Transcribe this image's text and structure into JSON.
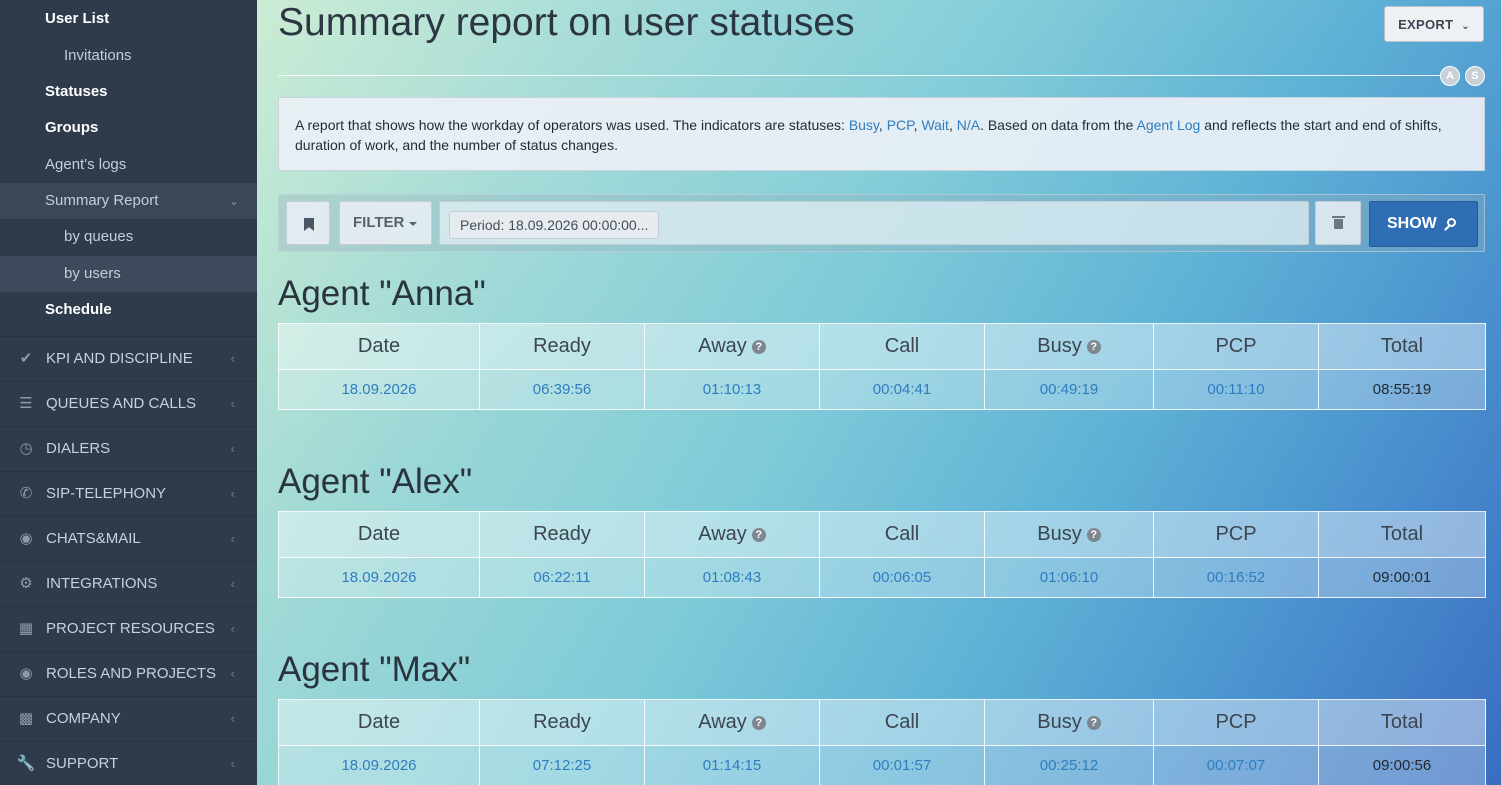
{
  "sidebar": {
    "sub_items": [
      {
        "label": "User List"
      },
      {
        "label": "Invitations"
      },
      {
        "label": "Statuses"
      },
      {
        "label": "Groups"
      },
      {
        "label": "Agent's logs"
      },
      {
        "label": "Summary Report"
      },
      {
        "label": "by queues"
      },
      {
        "label": "by users"
      },
      {
        "label": "Schedule"
      }
    ],
    "menu": [
      {
        "label": "KPI AND DISCIPLINE",
        "icon": "check-icon"
      },
      {
        "label": "QUEUES AND CALLS",
        "icon": "list-icon"
      },
      {
        "label": "DIALERS",
        "icon": "clock-icon"
      },
      {
        "label": "SIP-TELEPHONY",
        "icon": "phone-icon"
      },
      {
        "label": "CHATS&MAIL",
        "icon": "chat-icon"
      },
      {
        "label": "INTEGRATIONS",
        "icon": "gears-icon"
      },
      {
        "label": "PROJECT RESOURCES",
        "icon": "grid-icon"
      },
      {
        "label": "ROLES AND PROJECTS",
        "icon": "toggle-icon"
      },
      {
        "label": "COMPANY",
        "icon": "bar-chart-icon"
      },
      {
        "label": "SUPPORT",
        "icon": "wrench-icon"
      }
    ]
  },
  "header": {
    "title": "Summary report on user statuses",
    "export_label": "EXPORT",
    "badge_a": "A",
    "badge_s": "S"
  },
  "info": {
    "text1": "A report that shows how the workday of operators was used. The indicators are statuses: ",
    "busy": "Busy",
    "sep1": ", ",
    "pcp": "PCP",
    "sep2": ", ",
    "wait": "Wait",
    "sep3": ", ",
    "na": "N/A",
    "text2": ". Based on data from the ",
    "agent_log": "Agent Log",
    "text3": " and reflects the start and end of shifts, duration of work, and the number of status changes."
  },
  "filter": {
    "filter_label": "FILTER",
    "period_tag": "Period: 18.09.2026 00:00:00...",
    "show_label": "SHOW"
  },
  "columns": [
    "Date",
    "Ready",
    "Away",
    "Call",
    "Busy",
    "PCP",
    "Total"
  ],
  "agents": [
    {
      "title": "Agent \"Anna\"",
      "row": [
        "18.09.2026",
        "06:39:56",
        "01:10:13",
        "00:04:41",
        "00:49:19",
        "00:11:10",
        "08:55:19"
      ]
    },
    {
      "title": "Agent \"Alex\"",
      "row": [
        "18.09.2026",
        "06:22:11",
        "01:08:43",
        "00:06:05",
        "01:06:10",
        "00:16:52",
        "09:00:01"
      ]
    },
    {
      "title": "Agent \"Max\"",
      "row": [
        "18.09.2026",
        "07:12:25",
        "01:14:15",
        "00:01:57",
        "00:25:12",
        "00:07:07",
        "09:00:56"
      ]
    }
  ]
}
